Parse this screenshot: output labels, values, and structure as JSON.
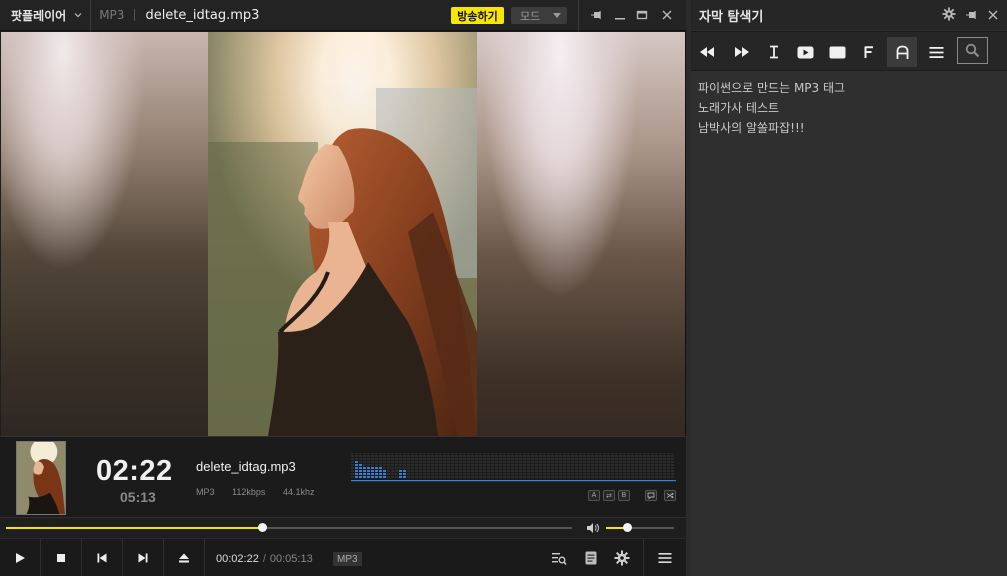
{
  "app": {
    "name": "팟플레이어",
    "format": "MP3",
    "filename": "delete_idtag.mp3",
    "broadcast_label": "방송하기",
    "mode_label": "모드"
  },
  "info": {
    "time_current": "02:22",
    "time_total": "05:13",
    "title": "delete_idtag.mp3",
    "codec": "MP3",
    "bitrate": "112kbps",
    "samplerate": "44.1khz",
    "mini_buttons": [
      "A",
      "⇄",
      "B",
      "",
      ""
    ]
  },
  "seek": {
    "progress": 0.453,
    "volume": 0.32
  },
  "controls": {
    "time_current": "00:02:22",
    "separator": "/",
    "time_total": "00:05:13",
    "format_badge": "MP3"
  },
  "lyrics": {
    "title": "자막 탐색기",
    "toolbar": [
      "rewind",
      "fast-forward",
      "I",
      "play",
      "screen",
      "F",
      "A",
      "menu",
      "search"
    ],
    "lines": [
      "파이썬으로 만드는 MP3 태그",
      "노래가사 테스트",
      "남박사의 알쏠파잡!!!"
    ]
  },
  "colors": {
    "accent": "#f7e600",
    "spectrum": "#3a7fd0"
  }
}
